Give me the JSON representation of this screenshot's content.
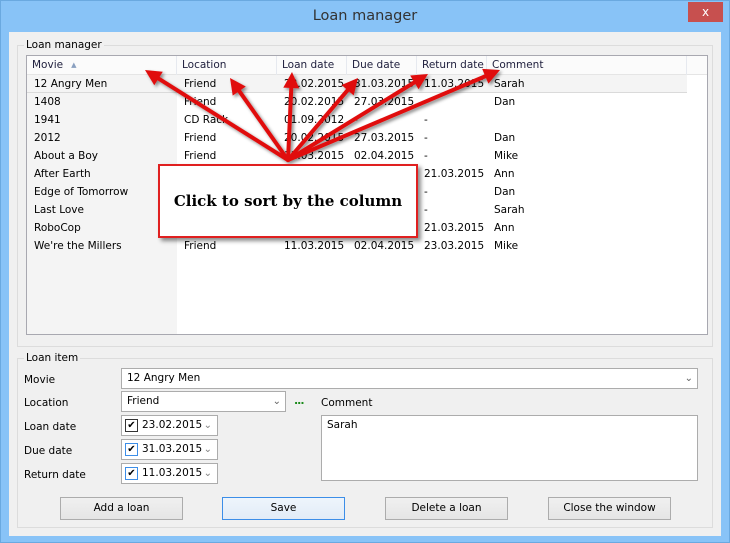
{
  "window": {
    "title": "Loan manager",
    "close_label": "x"
  },
  "list_group": {
    "label": "Loan manager",
    "columns": [
      "Movie",
      "Location",
      "Loan date",
      "Due date",
      "Return date",
      "Comment"
    ],
    "sort_column": "Movie",
    "sort_direction": "ascending",
    "sort_indicator": "▲",
    "rows": [
      {
        "movie": "12 Angry Men",
        "location": "Friend",
        "loan_date": "23.02.2015",
        "due_date": "31.03.2015",
        "return_date": "11.03.2015",
        "comment": "Sarah",
        "selected": true
      },
      {
        "movie": "1408",
        "location": "Friend",
        "loan_date": "20.02.2015",
        "due_date": "27.03.2015",
        "return_date": "-",
        "comment": "Dan"
      },
      {
        "movie": "1941",
        "location": "CD Rack",
        "loan_date": "01.09.2012",
        "due_date": "-",
        "return_date": "-",
        "comment": ""
      },
      {
        "movie": "2012",
        "location": "Friend",
        "loan_date": "20.02.2015",
        "due_date": "27.03.2015",
        "return_date": "-",
        "comment": "Dan"
      },
      {
        "movie": "About a Boy",
        "location": "Friend",
        "loan_date": "11.03.2015",
        "due_date": "02.04.2015",
        "return_date": "-",
        "comment": "Mike"
      },
      {
        "movie": "After Earth",
        "location": "",
        "loan_date": "",
        "due_date": "",
        "return_date": "21.03.2015",
        "comment": "Ann"
      },
      {
        "movie": "Edge of Tomorrow",
        "location": "",
        "loan_date": "",
        "due_date": "",
        "return_date": "-",
        "comment": "Dan"
      },
      {
        "movie": "Last Love",
        "location": "",
        "loan_date": "",
        "due_date": "",
        "return_date": "-",
        "comment": "Sarah"
      },
      {
        "movie": "RoboCop",
        "location": "",
        "loan_date": "",
        "due_date": "",
        "return_date": "21.03.2015",
        "comment": "Ann"
      },
      {
        "movie": "We're the Millers",
        "location": "Friend",
        "loan_date": "11.03.2015",
        "due_date": "02.04.2015",
        "return_date": "23.03.2015",
        "comment": "Mike"
      }
    ]
  },
  "item_group": {
    "label": "Loan item",
    "movie_label": "Movie",
    "movie_value": "12 Angry Men",
    "location_label": "Location",
    "location_value": "Friend",
    "ellipsis_label": "...",
    "comment_label": "Comment",
    "comment_value": "Sarah",
    "loan_date_label": "Loan date",
    "loan_date_value": "23.02.2015",
    "loan_date_checked": true,
    "due_date_label": "Due date",
    "due_date_value": "31.03.2015",
    "due_date_checked": true,
    "return_date_label": "Return date",
    "return_date_value": "11.03.2015",
    "return_date_checked": true,
    "check_mark": "✔",
    "chevron": "⌄"
  },
  "buttons": {
    "add": "Add a loan",
    "save": "Save",
    "delete": "Delete a loan",
    "close": "Close the window"
  },
  "annotation": {
    "text": "Click to sort by the column",
    "color": "#e01010"
  }
}
